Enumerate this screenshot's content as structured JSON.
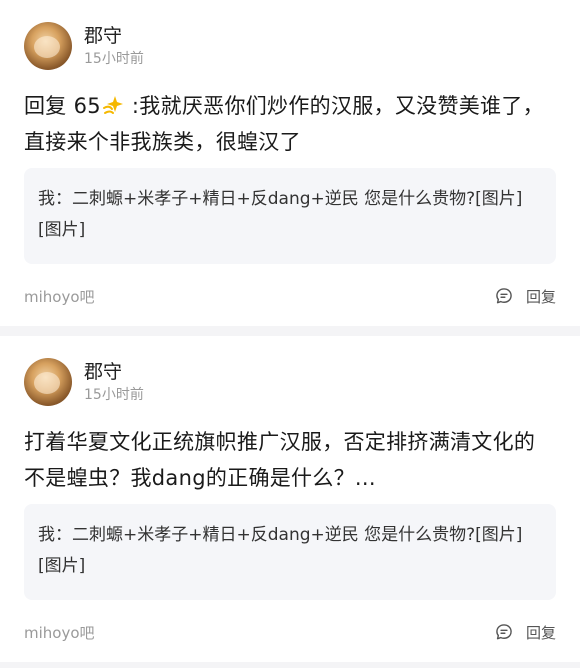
{
  "posts": [
    {
      "username": "郡守",
      "time": "15小时前",
      "text_prefix": "回复 65",
      "emoji": "sparkle-icon",
      "text_suffix": " :我就厌恶你们炒作的汉服，又没赞美谁了，直接来个非我族类，很蝗汉了",
      "quote": "我：二刺螈+米孝子+精日+反dang+逆民 您是什么贵物?[图片][图片]",
      "forum": "mihoyo吧",
      "reply_label": "回复"
    },
    {
      "username": "郡守",
      "time": "15小时前",
      "text_prefix": "打着华夏文化正统旗帜推广汉服，否定排挤满清文化的不是蝗虫？我dang的正确是什么？...",
      "emoji": "",
      "text_suffix": "",
      "quote": "我：二刺螈+米孝子+精日+反dang+逆民 您是什么贵物?[图片][图片]",
      "forum": "mihoyo吧",
      "reply_label": "回复"
    }
  ],
  "colors": {
    "background": "#f4f4f6",
    "card": "#ffffff",
    "quote_bg": "#f5f6f9",
    "muted_text": "#9a9a9a",
    "sparkle": "#f5b800"
  }
}
